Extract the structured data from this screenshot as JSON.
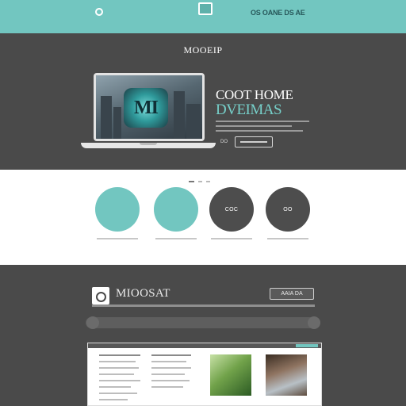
{
  "topbar": {
    "logo_icon": "circle-logo-icon",
    "tagline": "",
    "center_icon": "square-icon",
    "nav_link": "OS OANE DS AE"
  },
  "hero": {
    "brand": "MOOEIP",
    "headline_1": "COOT HOME",
    "headline_2": "DVEIMAS",
    "screen_emblem": "MI",
    "cta_label": "",
    "small_label": "DO"
  },
  "features": {
    "items": [
      {
        "circle_text": "",
        "caption": "",
        "color": "#72c6c0"
      },
      {
        "circle_text": "",
        "caption": "",
        "color": "#72c6c0"
      },
      {
        "circle_text": "COC",
        "caption": "",
        "color": "#4d4d4d"
      },
      {
        "circle_text": "OO",
        "caption": "",
        "color": "#4d4d4d"
      }
    ]
  },
  "section2": {
    "title": "MIOOSAT",
    "button_label": "AAIA DA",
    "pill_labels": [
      "",
      "",
      ""
    ]
  },
  "colors": {
    "accent": "#72c6c0",
    "dark": "#4a4a4a",
    "light": "#ffffff"
  }
}
